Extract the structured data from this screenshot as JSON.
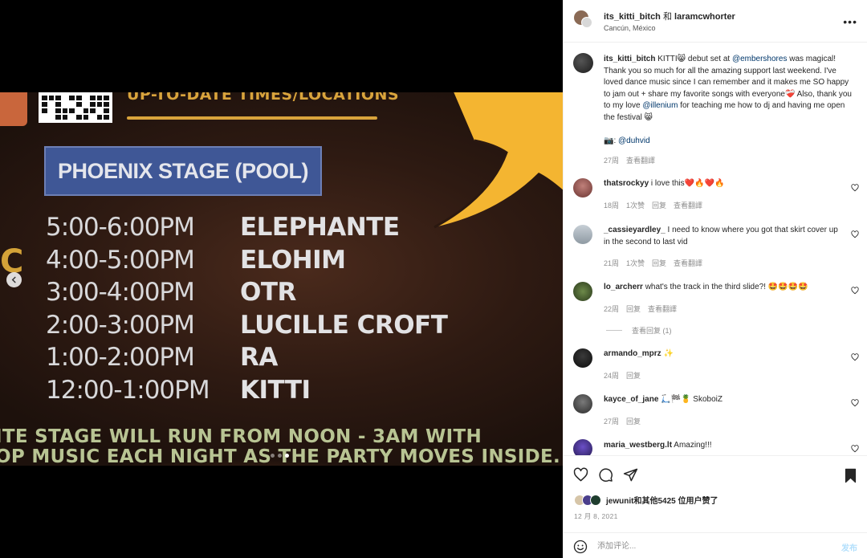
{
  "media": {
    "banner_text": "UP-TO-DATE TIMES/LOCATIONS",
    "stage_title": "PHOENIX STAGE (POOL)",
    "side_letter": "C",
    "schedule": [
      {
        "time": "5:00-6:00PM",
        "act": "ELEPHANTE"
      },
      {
        "time": "4:00-5:00PM",
        "act": "ELOHIM"
      },
      {
        "time": "3:00-4:00PM",
        "act": "OTR"
      },
      {
        "time": "2:00-3:00PM",
        "act": "LUCILLE CROFT"
      },
      {
        "time": "1:00-2:00PM",
        "act": "RA"
      },
      {
        "time": "12:00-1:00PM",
        "act": "KITTI"
      }
    ],
    "footer_line1": "ITE STAGE WILL RUN FROM NOON - 3AM WITH",
    "footer_line2": "OP MUSIC EACH NIGHT AS THE PARTY MOVES INSIDE.",
    "carousel_dots": 3,
    "carousel_active": 2
  },
  "post": {
    "author": "its_kitti_bitch",
    "and_text": " 和 ",
    "coauthor": "laramcwhorter",
    "location": "Cancún, México",
    "more_icon": "more-horizontal-icon"
  },
  "caption": {
    "username": "its_kitti_bitch",
    "part1": " KITTI😸 debut set at ",
    "mention1": "@embershores",
    "part2": " was magical! Thank you so much for all the amazing support last weekend. I've loved dance music since I can remember and it makes me SO happy to jam out + share my favorite songs with everyone❤️‍🩹 Also, thank you to my love ",
    "mention2": "@illenium",
    "part3": " for teaching me how to dj and having me open the festival 😸",
    "credit_prefix": "📷: ",
    "credit_mention": "@duhvid",
    "age": "27周",
    "see_translation": "查看翻譯"
  },
  "comments": [
    {
      "username": "thatsrockyy",
      "text": " i love this❤️🔥❤️🔥",
      "age": "18周",
      "likes": "1次赞",
      "reply": "回复",
      "see_translation": "查看翻譯"
    },
    {
      "username": "_cassieyardley_",
      "text": " I need to know where you got that skirt cover up in the second to last vid",
      "age": "21周",
      "likes": "1次赞",
      "reply": "回复",
      "see_translation": "查看翻譯"
    },
    {
      "username": "lo_archerr",
      "text": " what's the track in the third slide?! 🤩🤩🤩🤩",
      "age": "22周",
      "reply": "回复",
      "see_translation": "查看翻譯"
    },
    {
      "username": "armando_mprz",
      "text": " ✨",
      "age": "24周",
      "reply": "回复"
    },
    {
      "username": "kayce_of_jane",
      "text": " 🛴🏁🍍 SkoboiZ",
      "age": "27周",
      "reply": "回复"
    },
    {
      "username": "maria_westberg.lt",
      "text": " Amazing!!!"
    }
  ],
  "view_replies": "查看回复 (1)",
  "actions": {
    "like_icon": "heart-icon",
    "comment_icon": "comment-icon",
    "share_icon": "send-icon",
    "save_icon": "bookmark-icon"
  },
  "likes": {
    "username": "jewunit",
    "rest": "和其他5425 位用户赞了"
  },
  "date": "12 月 8, 2021",
  "comment_box": {
    "placeholder": "添加评论...",
    "post_label": "发布"
  },
  "colors": {
    "link": "#00376b",
    "muted": "#8e8e8e",
    "post_disabled": "#b2dffc",
    "stage_blue": "#3f5796",
    "banner_gold": "#d9a43c"
  }
}
